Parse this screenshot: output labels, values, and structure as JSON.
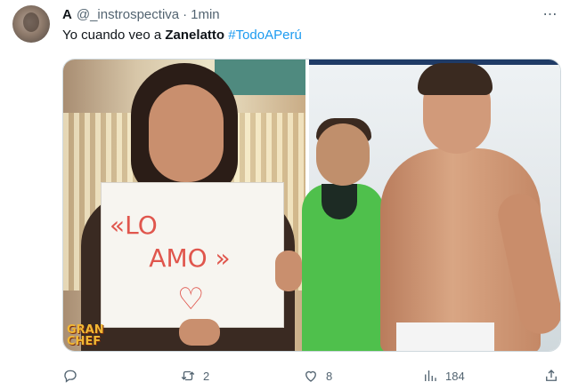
{
  "tweet": {
    "author_name": "A",
    "author_handle": "@_instrospectiva",
    "separator": "·",
    "time": "1min",
    "more_icon": "⋯",
    "text_prefix": "Yo cuando veo a ",
    "text_bold": "Zanelatto",
    "text_hashtag": "#TodoAPerú"
  },
  "media": {
    "sign_line1": "«LO",
    "sign_line2": "AMO »",
    "sign_heart": "♡",
    "logo_text_1": "GRAN",
    "logo_text_2": "CHEF"
  },
  "actions": {
    "reply_icon": "reply-icon",
    "retweet_icon": "retweet-icon",
    "retweet_count": "2",
    "like_icon": "heart-icon",
    "like_count": "8",
    "views_icon": "views-icon",
    "views_count": "184",
    "share_icon": "share-icon"
  }
}
